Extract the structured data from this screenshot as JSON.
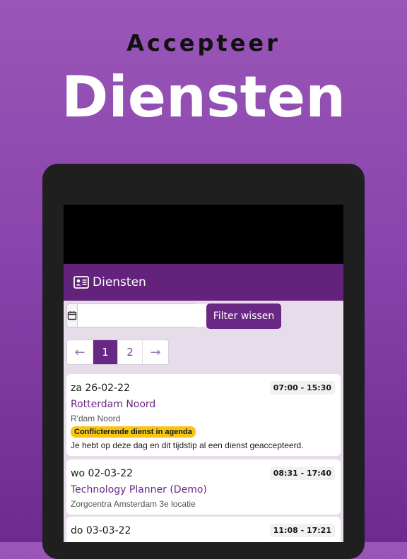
{
  "hero": {
    "subtitle": "Accepteer",
    "title": "Diensten"
  },
  "app_bar": {
    "icon": "id-card-icon",
    "title": "Diensten"
  },
  "filter": {
    "calendar_icon": "calendar-icon",
    "date_value": "",
    "clear_label": "Filter wissen"
  },
  "pagination": {
    "prev": "←",
    "pages": [
      "1",
      "2"
    ],
    "active_page": "1",
    "next": "→"
  },
  "shifts": [
    {
      "date": "za 26-02-22",
      "time": "07:00 - 15:30",
      "place": "Rotterdam Noord",
      "location": "R'dam Noord",
      "badge": "Conflicterende dienst in agenda",
      "note": "Je hebt op deze dag en dit tijdstip al een dienst geaccepteerd."
    },
    {
      "date": "wo 02-03-22",
      "time": "08:31 - 17:40",
      "place": "Technology Planner (Demo)",
      "location": "Zorgcentra Amsterdam 3e locatie"
    },
    {
      "date": "do 03-03-22",
      "time": "11:08 - 17:21"
    }
  ],
  "colors": {
    "brand_purple": "#63237d",
    "badge_yellow": "#f5c518"
  }
}
